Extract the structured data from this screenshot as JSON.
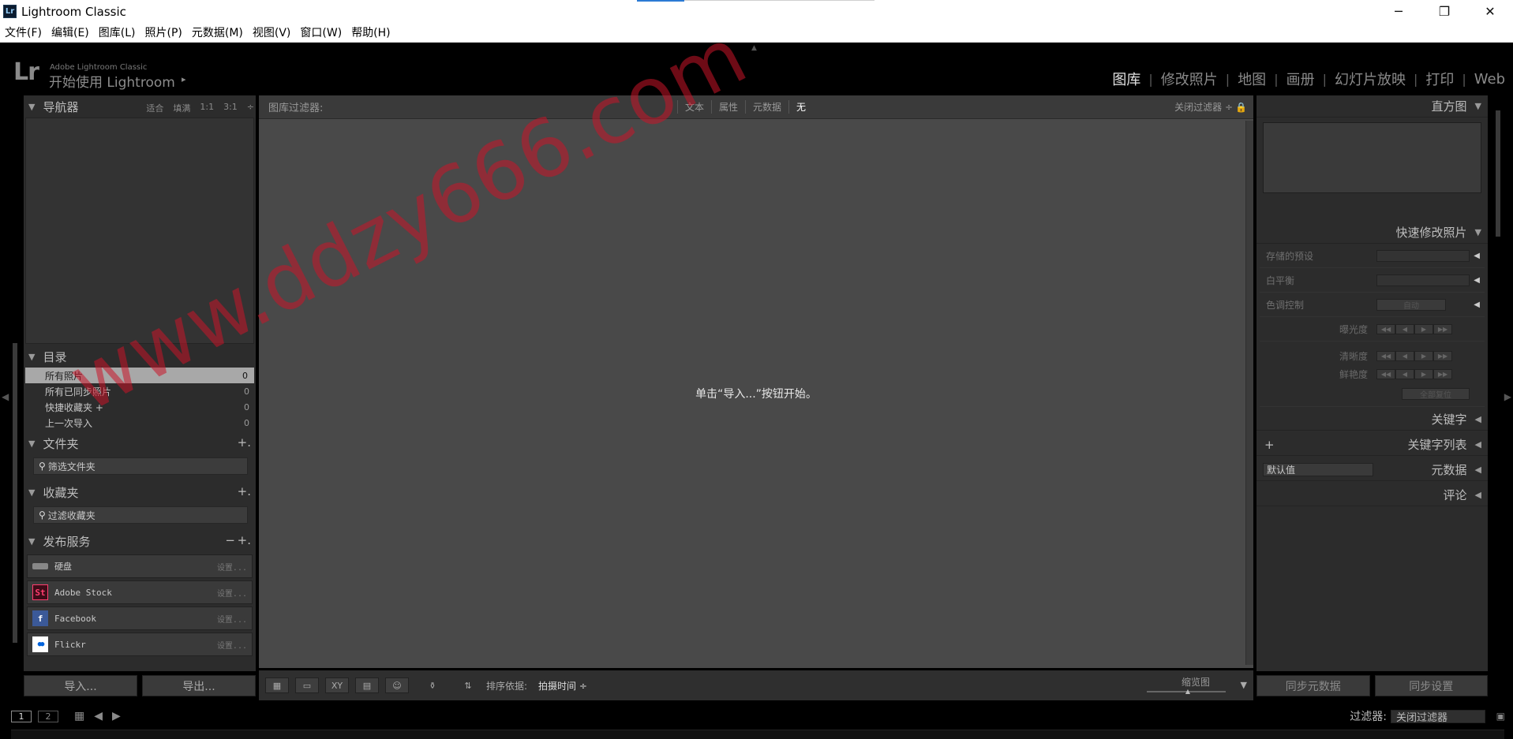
{
  "window": {
    "title": "Lightroom Classic",
    "app_badge": "Lr",
    "controls": [
      "─",
      "❐",
      "✕"
    ]
  },
  "menu": [
    "文件(F)",
    "编辑(E)",
    "图库(L)",
    "照片(P)",
    "元数据(M)",
    "视图(V)",
    "窗口(W)",
    "帮助(H)"
  ],
  "identity": {
    "logo": "Lr",
    "brand": "Adobe Lightroom Classic",
    "start": "开始使用 Lightroom",
    "start_arrow": "▸",
    "top_arrow": "▲"
  },
  "modules": [
    "图库",
    "修改照片",
    "地图",
    "画册",
    "幻灯片放映",
    "打印",
    "Web"
  ],
  "active_module": "图库",
  "navigator": {
    "title": "导航器",
    "options": [
      "适合",
      "填满",
      "1:1",
      "3:1"
    ]
  },
  "catalog": {
    "title": "目录",
    "items": [
      {
        "label": "所有照片",
        "count": "0"
      },
      {
        "label": "所有已同步照片",
        "count": "0"
      },
      {
        "label": "快捷收藏夹 +",
        "count": "0"
      },
      {
        "label": "上一次导入",
        "count": "0"
      }
    ]
  },
  "folders": {
    "title": "文件夹",
    "plus": "+.",
    "search": "筛选文件夹"
  },
  "collections": {
    "title": "收藏夹",
    "plus": "+.",
    "search": "过滤收藏夹"
  },
  "publish": {
    "title": "发布服务",
    "minus": "−",
    "plus": "+.",
    "services": [
      {
        "label": "硬盘",
        "icon_text": "",
        "setup": "设置..."
      },
      {
        "label": "Adobe Stock",
        "icon_text": "St",
        "setup": "设置..."
      },
      {
        "label": "Facebook",
        "icon_text": "f",
        "setup": "设置..."
      },
      {
        "label": "Flickr",
        "icon_text": "●●",
        "setup": "设置..."
      }
    ]
  },
  "left_buttons": {
    "import": "导入...",
    "export": "导出..."
  },
  "filter_bar": {
    "label": "图库过滤器:",
    "options": [
      "文本",
      "属性",
      "元数据",
      "无"
    ],
    "active": "无",
    "close": "关闭过滤器 ÷",
    "lock": "🔒"
  },
  "center": {
    "hint": "单击“导入...”按钮开始。"
  },
  "toolbar": {
    "sort_label": "排序依据:",
    "sort_value": "拍摄时间 ÷",
    "thumb_label": "缩览图",
    "dropdown": "▼"
  },
  "right": {
    "histogram": "直方图",
    "quick_develop": "快速修改照片",
    "qd_rows": {
      "preset": "存储的预设",
      "wb": "白平衡",
      "tone": "色调控制",
      "auto": "自动",
      "exposure": "曝光度",
      "clarity": "清晰度",
      "vibrance": "鲜艳度",
      "reset": "全部复位"
    },
    "keywording": "关键字",
    "keyword_list": "关键字列表",
    "metadata": "元数据",
    "metadata_preset": "默认值",
    "comments": "评论",
    "sync_metadata": "同步元数据",
    "sync_settings": "同步设置"
  },
  "filmstrip": {
    "page1": "1",
    "page2": "2",
    "filter_label": "过滤器:",
    "filter_value": "关闭过滤器"
  },
  "watermark": "www.ddzy666.com",
  "colors": {
    "accent_blue": "#2b7ad4",
    "watermark": "#c81428",
    "panel_bg": "#2c2c2c",
    "center_bg": "#494949"
  }
}
